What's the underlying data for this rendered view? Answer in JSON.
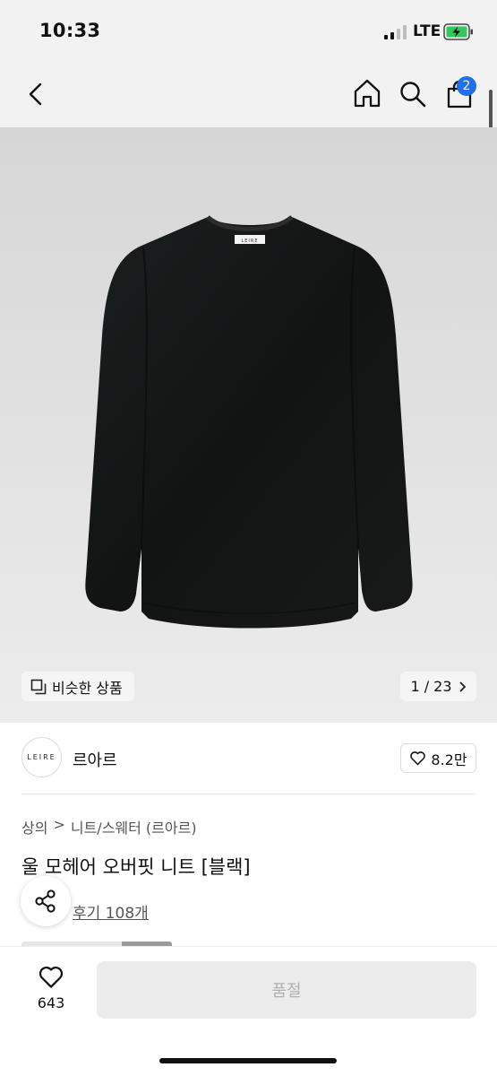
{
  "status_bar": {
    "time": "10:33",
    "network": "LTE",
    "signal_icon": "cellular-signal-icon",
    "battery_icon": "battery-charging-icon"
  },
  "nav": {
    "back_icon": "chevron-left-icon",
    "home_icon": "home-icon",
    "search_icon": "search-icon",
    "cart_icon": "shopping-bag-icon",
    "cart_count": "2",
    "badge_color": "#1f6fe6"
  },
  "hero": {
    "garment_label": "LEIRE",
    "similar_label": "비슷한 상품",
    "similar_icon": "copy-icon",
    "counter": "1 / 23",
    "counter_icon": "chevron-right-icon"
  },
  "brand": {
    "logo_text": "LEIRE",
    "name": "르아르",
    "likes": "8.2만",
    "like_icon": "heart-outline-icon"
  },
  "breadcrumb": {
    "category": "상의",
    "separator": ">",
    "subcategory": "니트/스웨터 (르아르)"
  },
  "product": {
    "title": "울 모헤어 오버핏 니트 [블랙]",
    "reviews": "후기 108개"
  },
  "share_icon": "share-icon",
  "bottom": {
    "wish_icon": "heart-outline-icon",
    "wish_count": "643",
    "soldout_label": "품절"
  }
}
